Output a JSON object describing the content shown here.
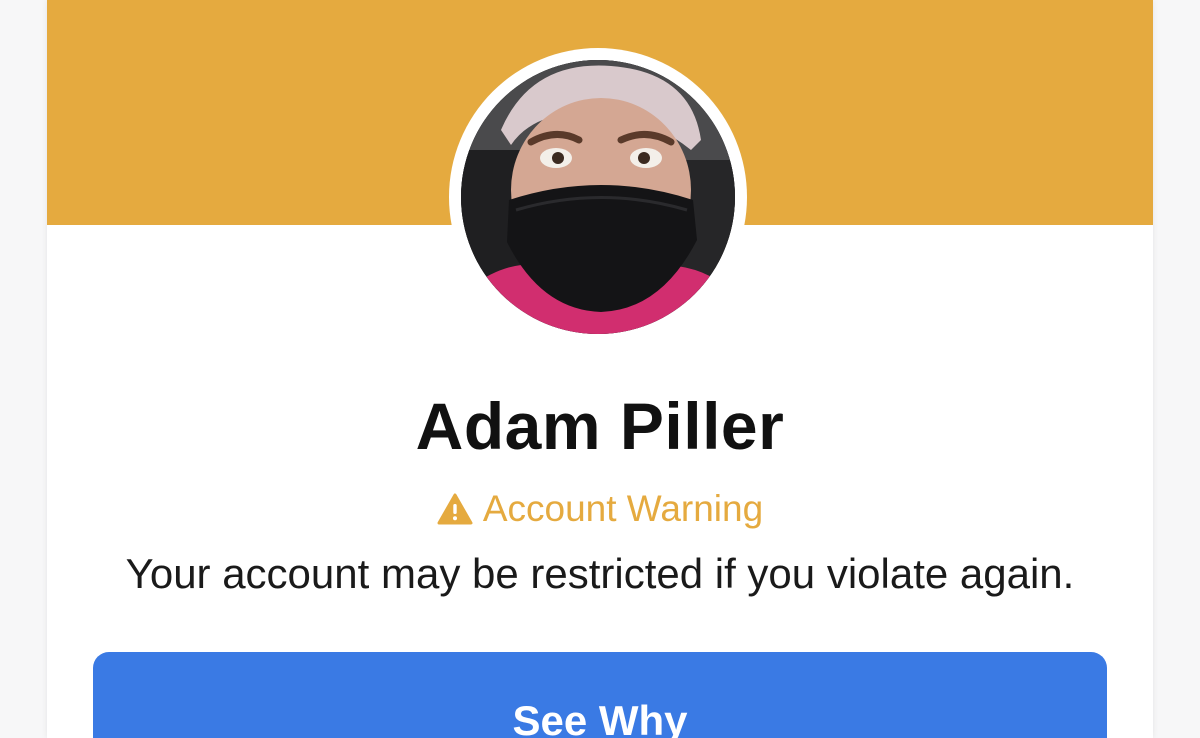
{
  "profile": {
    "name": "Adam Piller",
    "banner_color": "#e5aa3f",
    "avatar": "profile-photo"
  },
  "warning": {
    "icon": "warning-triangle-icon",
    "label": "Account Warning",
    "color": "#e5aa3f",
    "message": "Your account may be restricted if you violate again."
  },
  "actions": {
    "see_why_label": "See Why",
    "button_color": "#3a7ae4"
  }
}
